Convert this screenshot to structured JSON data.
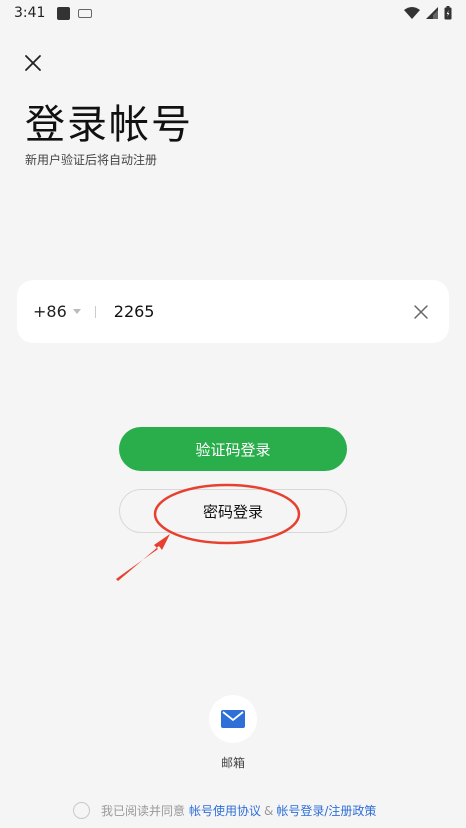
{
  "status_bar": {
    "time": "3:41",
    "icons": [
      "notification-square-icon",
      "keyboard-icon",
      "wifi-icon",
      "signal-icon",
      "battery-icon"
    ]
  },
  "header": {
    "close_icon": "close-icon",
    "title": "登录帐号",
    "subtitle": "新用户验证后将自动注册"
  },
  "phone_input": {
    "country_code": "+86",
    "value": "2265",
    "clear_icon": "clear-icon"
  },
  "buttons": {
    "sms_login": "验证码登录",
    "password_login": "密码登录"
  },
  "alt_login": {
    "mail_icon": "mail-icon",
    "mail_label": "邮箱"
  },
  "agreement": {
    "prefix": "我已阅读并同意",
    "link_terms": "帐号使用协议",
    "separator": "&",
    "link_policy": "帐号登录/注册政策"
  },
  "colors": {
    "primary_green": "#2aae4c",
    "link_blue": "#2f6fd8",
    "annotation_red": "#e8402f",
    "mail_blue": "#2f6fd8",
    "background": "#f5f5f5"
  }
}
